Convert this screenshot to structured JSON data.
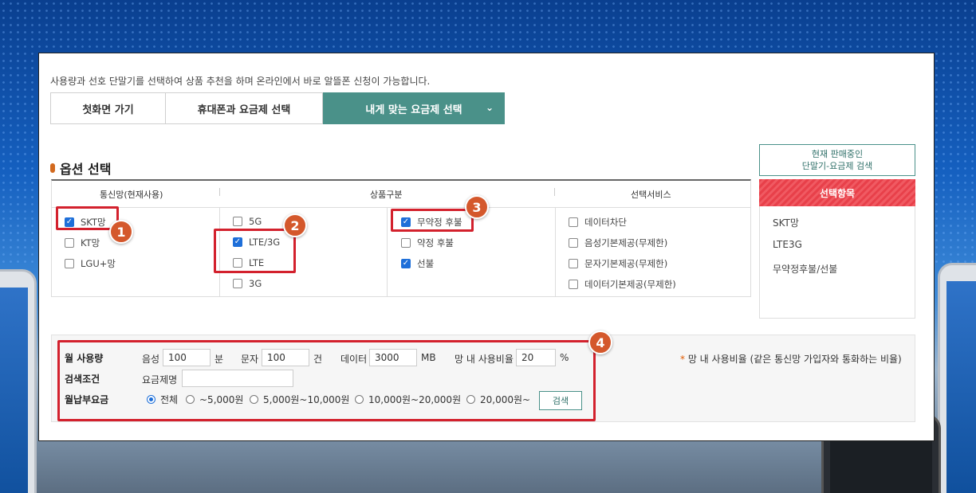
{
  "intro_text": "사용량과 선호 단말기를 선택하여 상품 추천을 하며 온라인에서 바로 알뜰폰 신청이 가능합니다.",
  "tabs": [
    {
      "label": "첫화면 가기"
    },
    {
      "label": "휴대폰과 요금제 선택"
    },
    {
      "label": "내게 맞는 요금제 선택",
      "active": true
    }
  ],
  "section_title": "옵션 선택",
  "columns": {
    "network": {
      "header": "통신망(현재사용)",
      "items": [
        {
          "label": "SKT망",
          "checked": true
        },
        {
          "label": "KT망",
          "checked": false
        },
        {
          "label": "LGU+망",
          "checked": false
        }
      ]
    },
    "product": {
      "header": "상품구분",
      "items_left": [
        {
          "label": "5G",
          "checked": false
        },
        {
          "label": "LTE/3G",
          "checked": true
        },
        {
          "label": "LTE",
          "checked": false
        },
        {
          "label": "3G",
          "checked": false
        }
      ],
      "items_right": [
        {
          "label": "무약정 후불",
          "checked": true
        },
        {
          "label": "약정 후불",
          "checked": false
        },
        {
          "label": "선불",
          "checked": true
        }
      ]
    },
    "service": {
      "header": "선택서비스",
      "items": [
        {
          "label": "데이터차단",
          "checked": false
        },
        {
          "label": "음성기본제공(무제한)",
          "checked": false
        },
        {
          "label": "문자기본제공(무제한)",
          "checked": false
        },
        {
          "label": "데이터기본제공(무제한)",
          "checked": false
        }
      ]
    }
  },
  "side": {
    "search_button_line1": "현재 판매중인",
    "search_button_line2": "단말기-요금제 검색",
    "selected_header": "선택항목",
    "selected_items": [
      "SKT망",
      "LTE3G",
      "무약정후불/선불"
    ]
  },
  "badges": [
    "1",
    "2",
    "3",
    "4"
  ],
  "usage": {
    "label": "월 사용량",
    "voice_label": "음성",
    "voice_value": "100",
    "voice_unit": "분",
    "sms_label": "문자",
    "sms_value": "100",
    "sms_unit": "건",
    "data_label": "데이터",
    "data_value": "3000",
    "data_unit": "MB",
    "ratio_label": "망 내 사용비율",
    "ratio_value": "20",
    "ratio_unit": "%"
  },
  "search_cond": {
    "label": "검색조건",
    "plan_name_label": "요금제명",
    "plan_name_value": ""
  },
  "fee": {
    "label": "월납부요금",
    "options": [
      {
        "label": "전체",
        "selected": true
      },
      {
        "label": "~5,000원",
        "selected": false
      },
      {
        "label": "5,000원~10,000원",
        "selected": false
      },
      {
        "label": "10,000원~20,000원",
        "selected": false
      },
      {
        "label": "20,000원~",
        "selected": false
      }
    ],
    "search_button": "검색"
  },
  "note": {
    "star": "*",
    "text": "망 내 사용비율 (같은 통신망 가입자와 통화하는 비율)"
  },
  "colors": {
    "teal": "#4a9189",
    "red_highlight": "#d3212d",
    "badge": "#d4582c",
    "check_blue": "#1e6fd9"
  }
}
